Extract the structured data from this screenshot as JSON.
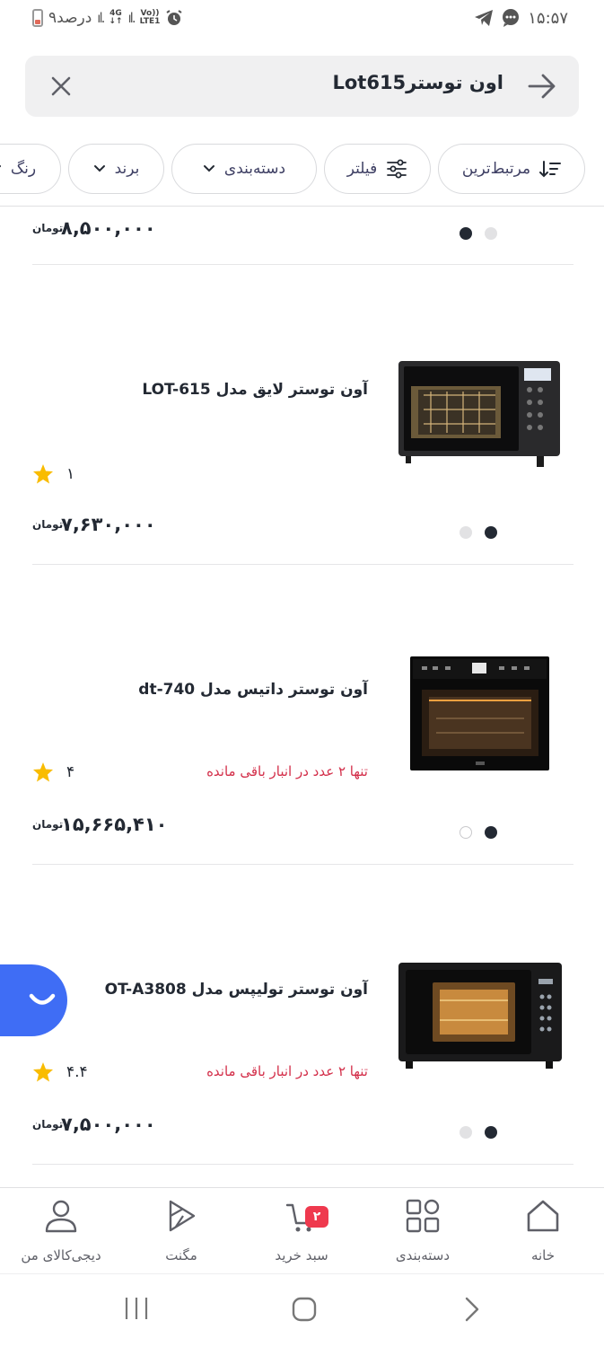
{
  "status_bar": {
    "battery_text": "۹درصد",
    "network_4g": "4G",
    "volte_top": "Vo))",
    "volte_bottom": "LTE1",
    "time": "۱۵:۵۷"
  },
  "search": {
    "query": "اون توسترLot615"
  },
  "filters": [
    {
      "label": "مرتبط‌ترین",
      "icon": "sort-icon"
    },
    {
      "label": "فیلتر",
      "icon": "filter-icon"
    },
    {
      "label": "دسته‌بندی",
      "icon": "chevron-down-icon"
    },
    {
      "label": "برند",
      "icon": "chevron-down-icon"
    },
    {
      "label": "رنگ",
      "icon": "chevron-down-icon"
    }
  ],
  "products": [
    {
      "price": "۸,۵۰۰,۰۰۰",
      "currency": "تومان",
      "dot_colors": [
        "#232933",
        "#e2e2e4"
      ]
    },
    {
      "title": "آون توستر لایق مدل LOT-615",
      "rating": "۱",
      "price": "۷,۶۳۰,۰۰۰",
      "currency": "تومان",
      "dot_colors": [
        "#e2e2e4",
        "#232933"
      ]
    },
    {
      "title": "آون توستر داتیس مدل dt-740",
      "stock": "تنها ۲ عدد در انبار باقی مانده",
      "rating": "۴",
      "price": "۱۵,۶۶۵,۴۱۰",
      "currency": "تومان",
      "dot_colors": [
        "#ffffff",
        "#232933"
      ]
    },
    {
      "title": "آون توستر تولیپس مدل OT-A3808",
      "stock": "تنها ۲ عدد در انبار باقی مانده",
      "rating": "۴.۴",
      "price": "۷,۵۰۰,۰۰۰",
      "currency": "تومان",
      "dot_colors": [
        "#e2e2e4",
        "#232933"
      ]
    }
  ],
  "bottom_nav": {
    "home": "خانه",
    "categories": "دسته‌بندی",
    "cart": "سبد خرید",
    "cart_count": "۲",
    "magnet": "مگنت",
    "profile": "دیجی‌کالای من"
  },
  "colors": {
    "accent_red": "#ef394e",
    "stock_red": "#d32f4a",
    "star": "#f9bc00",
    "fab_blue": "#3f6df5"
  }
}
